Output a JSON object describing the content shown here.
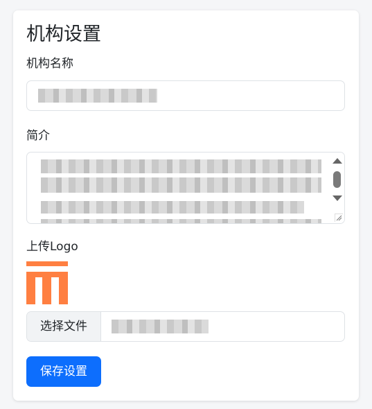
{
  "form": {
    "title": "机构设置",
    "name_label": "机构名称",
    "name_value": "",
    "intro_label": "简介",
    "intro_value": "",
    "logo_label": "上传Logo",
    "file_button_label": "选择文件",
    "file_name": "",
    "save_label": "保存设置"
  },
  "colors": {
    "primary": "#0d6efd",
    "logo_orange": "#ff7f41",
    "border": "#dee2e6"
  },
  "icons": {
    "logo": "orange-tt-logo",
    "scroll_up": "triangle-up-icon",
    "scroll_down": "triangle-down-icon",
    "resize": "resize-grip-icon"
  }
}
